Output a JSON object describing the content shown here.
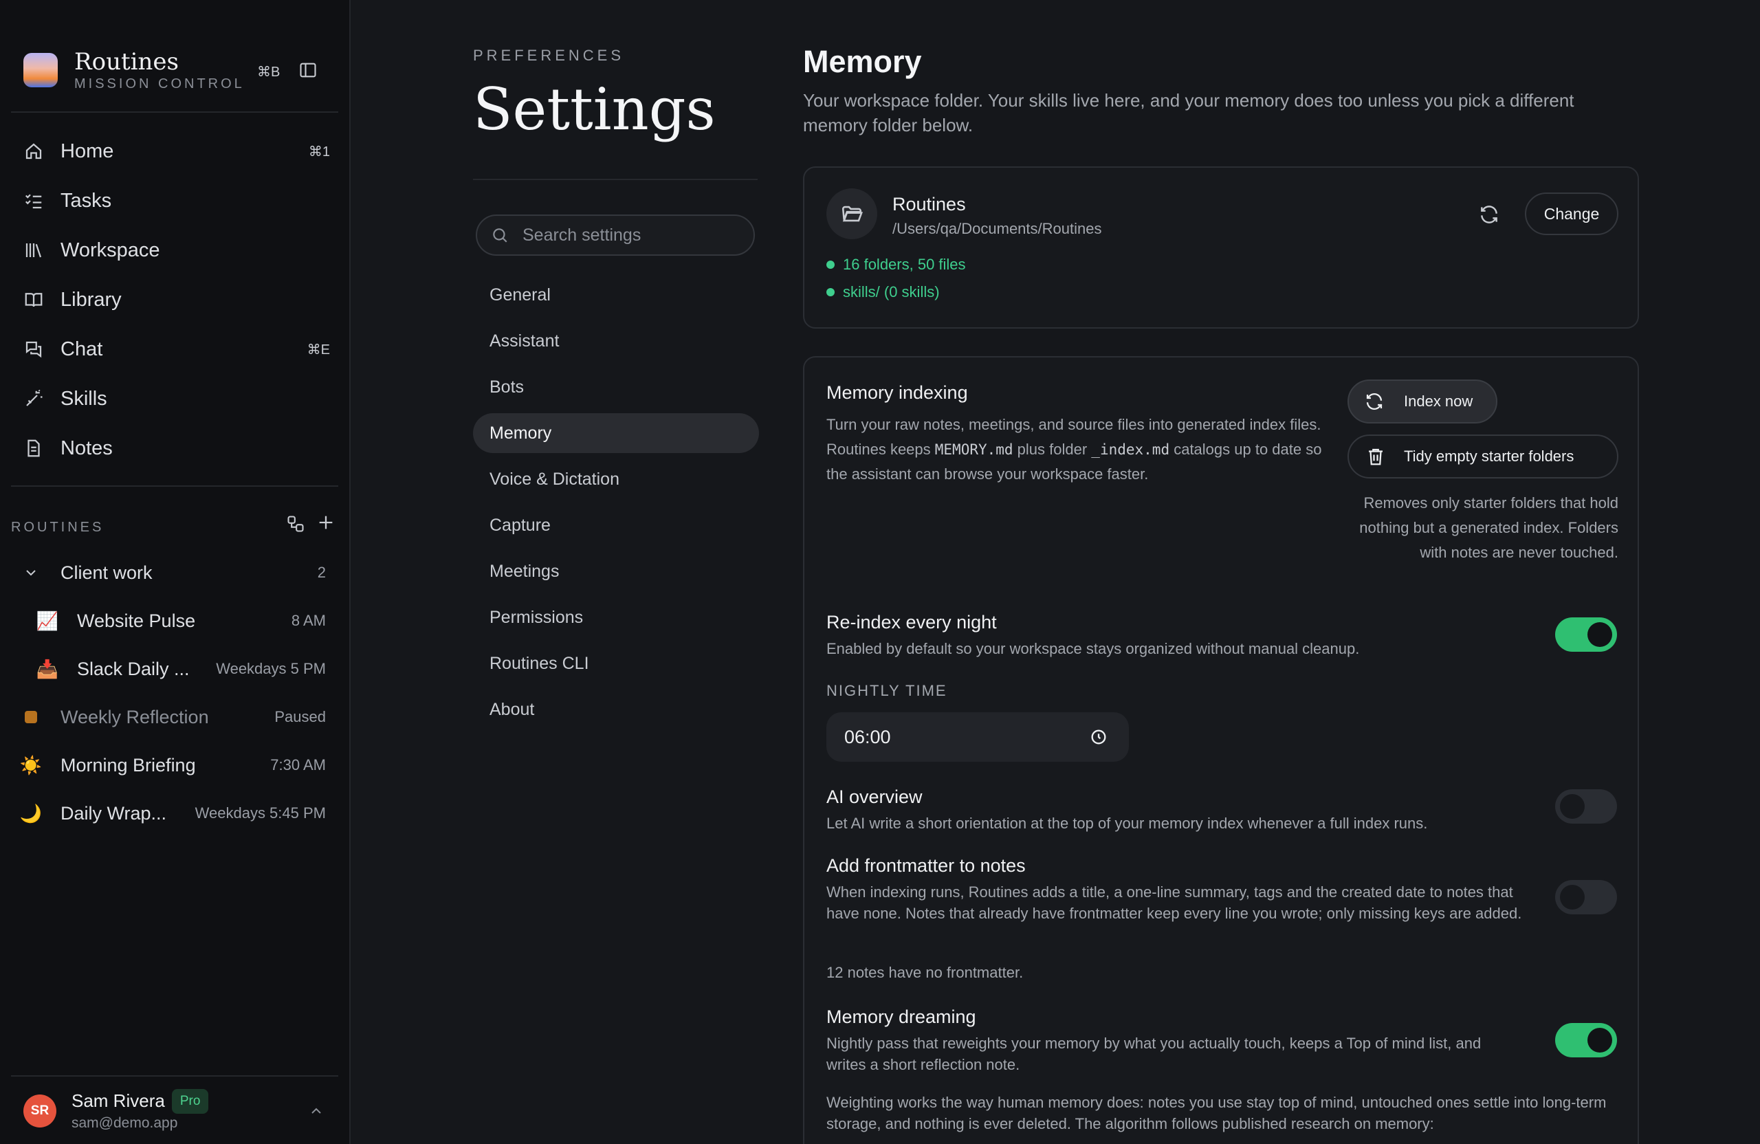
{
  "sidebar": {
    "brand_title": "Routines",
    "brand_subtitle": "MISSION CONTROL",
    "brand_shortcut": "⌘B",
    "nav": [
      {
        "label": "Home",
        "shortcut": "⌘1",
        "icon": "home-icon"
      },
      {
        "label": "Tasks",
        "shortcut": "",
        "icon": "tasks-icon"
      },
      {
        "label": "Workspace",
        "shortcut": "",
        "icon": "workspace-icon"
      },
      {
        "label": "Library",
        "shortcut": "",
        "icon": "book-icon"
      },
      {
        "label": "Chat",
        "shortcut": "⌘E",
        "icon": "chat-icon"
      },
      {
        "label": "Skills",
        "shortcut": "",
        "icon": "wand-icon"
      },
      {
        "label": "Notes",
        "shortcut": "",
        "icon": "note-icon"
      }
    ],
    "routines_label": "ROUTINES",
    "routines": [
      {
        "label": "Client work",
        "meta": "2",
        "icon": "⌄"
      },
      {
        "label": "Website Pulse",
        "meta": "8 AM",
        "icon": "📈"
      },
      {
        "label": "Slack Daily ...",
        "meta": "Weekdays 5 PM",
        "icon": "📥"
      },
      {
        "label": "Weekly Reflection",
        "meta": "Paused",
        "icon": "■"
      },
      {
        "label": "Morning Briefing",
        "meta": "7:30 AM",
        "icon": "☀️"
      },
      {
        "label": "Daily Wrap...",
        "meta": "Weekdays 5:45 PM",
        "icon": "🌙"
      }
    ],
    "user": {
      "initials": "SR",
      "name": "Sam Rivera",
      "badge": "Pro",
      "email": "sam@demo.app"
    }
  },
  "settings": {
    "eyebrow": "PREFERENCES",
    "title": "Settings",
    "search_placeholder": "Search settings",
    "menu": [
      "General",
      "Assistant",
      "Bots",
      "Memory",
      "Voice & Dictation",
      "Capture",
      "Meetings",
      "Permissions",
      "Routines CLI",
      "About"
    ],
    "active": "Memory"
  },
  "main": {
    "title": "Memory",
    "lead": "Your workspace folder. Your skills live here, and your memory does too unless you pick a different memory folder below.",
    "workspace": {
      "name": "Routines",
      "path": "/Users/qa/Documents/Routines",
      "change_label": "Change",
      "stats": [
        "16 folders, 50 files",
        "skills/ (0 skills)"
      ]
    },
    "indexing": {
      "title": "Memory indexing",
      "desc_1": "Turn your raw notes, meetings, and source files into generated index files. Routines keeps ",
      "code_1": "MEMORY.md",
      "desc_2": " plus folder ",
      "code_2": "_index.md",
      "desc_3": " catalogs up to date so the assistant can browse your workspace faster.",
      "index_button": "Index now",
      "tidy_button": "Tidy empty starter folders",
      "tidy_note": "Removes only starter folders that hold nothing but a generated index. Folders with notes are never touched."
    },
    "reindex": {
      "title": "Re-index every night",
      "desc": "Enabled by default so your workspace stays organized without manual cleanup.",
      "enabled": true
    },
    "nightly_label": "NIGHTLY TIME",
    "nightly_time": "06:00",
    "ai_overview": {
      "title": "AI overview",
      "desc": "Let AI write a short orientation at the top of your memory index whenever a full index runs.",
      "enabled": false
    },
    "frontmatter": {
      "title": "Add frontmatter to notes",
      "desc": "When indexing runs, Routines adds a title, a one-line summary, tags and the created date to notes that have none. Notes that already have frontmatter keep every line you wrote; only missing keys are added.",
      "enabled": false,
      "note": "12 notes have no frontmatter."
    },
    "dreaming": {
      "title": "Memory dreaming",
      "desc": "Nightly pass that reweights your memory by what you actually touch, keeps a Top of mind list, and writes a short reflection note.",
      "enabled": true,
      "extra": "Weighting works the way human memory does: notes you use stay top of mind, untouched ones settle into long-term storage, and nothing is ever deleted. The algorithm follows published research on memory:"
    },
    "colors": {
      "accent_green": "#2fbf71",
      "stat_green": "#3fcf8e",
      "avatar_red": "#e5533d"
    }
  }
}
